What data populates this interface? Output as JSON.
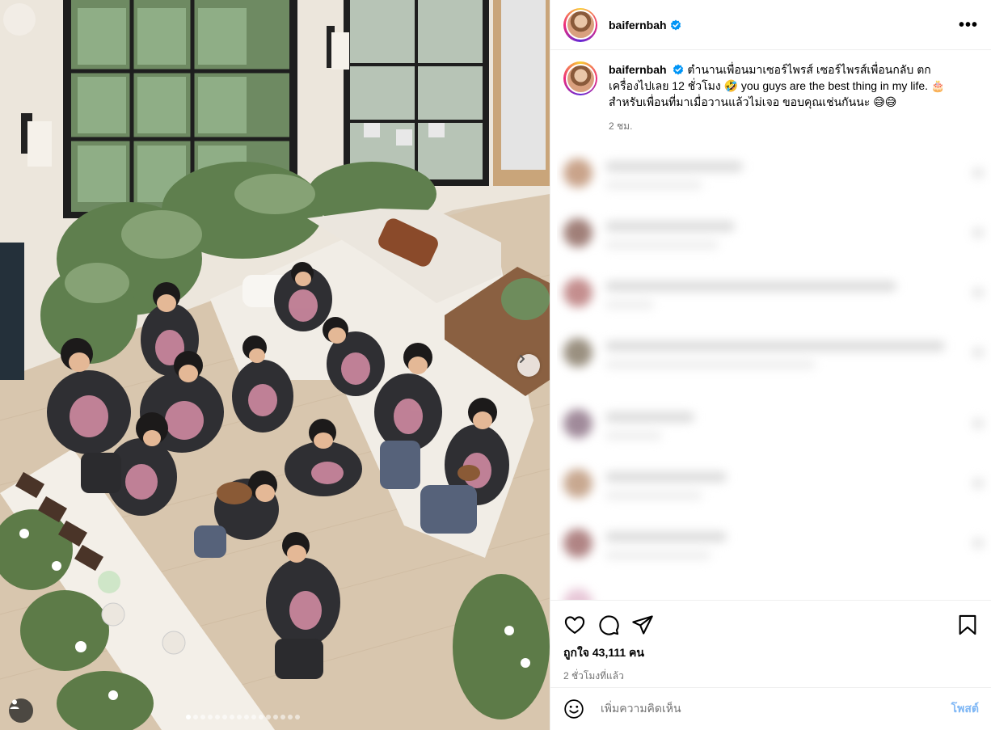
{
  "post": {
    "username": "baifernbah",
    "verified": true,
    "more_label": "•••",
    "caption": "ตำนานเพื่อนมาเซอร์ไพรส์ เซอร์ไพรส์เพื่อนกลับ ตกเครื่องไปเลย 12 ชั่วโมง 🤣 you guys are the best thing in my life. 🎂 สำหรับเพื่อนที่มาเมื่อวานแล้วไม่เจอ ขอบคุณเช่นกันนะ 😅😅",
    "caption_time": "2 ชม.",
    "likes": "ถูกใจ 43,111 คน",
    "posted_ago": "2 ชั่วโมงที่แล้ว"
  },
  "carousel": {
    "slide_count": 16,
    "active_slide": 1
  },
  "actions": {
    "like": "heart-icon",
    "comment": "comment-icon",
    "share": "share-icon",
    "save": "bookmark-icon"
  },
  "comment_box": {
    "placeholder": "เพิ่มความคิดเห็น",
    "post_label": "โพสต์",
    "emoji_icon": "emoji-icon"
  },
  "colors": {
    "accent": "#0095f6",
    "post_disabled": "#7fb7f5",
    "verified": "#0095f6"
  }
}
